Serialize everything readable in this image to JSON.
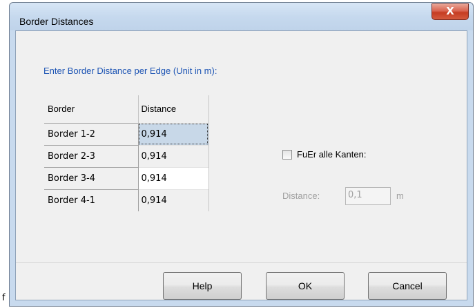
{
  "stray_text": "f",
  "window": {
    "title": "Border Distances",
    "close_glyph": "X"
  },
  "instruction": "Enter Border Distance per Edge  (Unit in m):",
  "table": {
    "columns": [
      "Border",
      "Distance"
    ],
    "rows": [
      {
        "border": "Border 1-2",
        "distance": "0,914"
      },
      {
        "border": "Border 2-3",
        "distance": "0,914"
      },
      {
        "border": "Border 3-4",
        "distance": "0,914"
      },
      {
        "border": "Border 4-1",
        "distance": "0,914"
      }
    ]
  },
  "all_edges": {
    "checkbox_label": "FuEr alle Kanten:",
    "checked": false,
    "distance_label": "Distance:",
    "distance_value": "0,1",
    "unit": "m"
  },
  "buttons": {
    "help": "Help",
    "ok": "OK",
    "cancel": "Cancel"
  },
  "colors": {
    "instruction_text": "#1e55b4",
    "selected_cell": "#c8d8e8",
    "close_button": "#c53c22",
    "disabled_text": "#a0a0a0"
  }
}
